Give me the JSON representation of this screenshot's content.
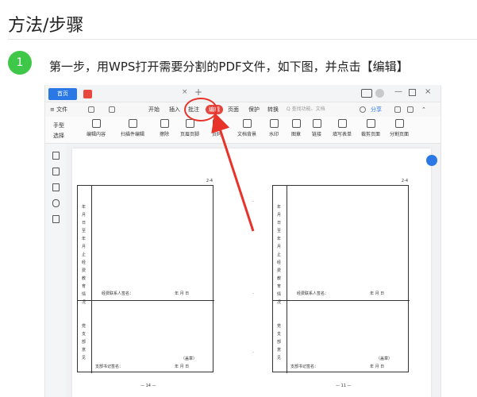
{
  "heading": {
    "title": "方法/步骤"
  },
  "step": {
    "number": "1",
    "text": "第一步，用WPS打开需要分割的PDF文件，如下图，并点击【编辑】"
  },
  "colors": {
    "step_green": "#3fc74a",
    "wps_blue": "#2a78e6",
    "highlight_red": "#e8332a"
  },
  "app": {
    "tabs": {
      "home": "首页",
      "close": "×",
      "new": "+"
    },
    "window": {
      "minimize": "—",
      "close": "×"
    },
    "menu": {
      "file": "≡ 文件",
      "items": [
        "开始",
        "插入",
        "批注",
        "编辑",
        "页面",
        "保护",
        "转换"
      ],
      "search_placeholder": "Q 查找功能、文档",
      "share": "分享"
    },
    "modes": {
      "hand": "手型",
      "select": "选择"
    },
    "tools": [
      "编辑内容",
      "扫描件编辑",
      "擦除",
      "页眉页脚",
      "页码",
      "文档背景",
      "水印",
      "图章",
      "链接",
      "填写表单",
      "裁剪页面",
      "分割页面"
    ],
    "left_icons": [
      "bookmark-icon",
      "image-icon",
      "comment-icon",
      "attachment-icon",
      "signature-icon"
    ]
  },
  "document": {
    "left_form": {
      "corner_number": "2-4",
      "upper_vertical": "年月日至年月止经费教育情况",
      "lower_vertical": "党支部意见",
      "upper_signature": "经费联系人签名：",
      "upper_date": "年  月  日",
      "lower_seal": "（盖章）",
      "lower_signature": "支部书记签名：",
      "lower_date": "年  月  日",
      "footer": "— 14 —"
    },
    "right_form": {
      "corner_number": "2-4",
      "upper_vertical": "年月日至年月止经费教育情况",
      "lower_vertical": "党支部意见",
      "upper_signature": "经费联系人签名：",
      "upper_date": "年  月  日",
      "lower_seal": "（盖章）",
      "lower_signature": "支部书记签名：",
      "lower_date": "年  月  日",
      "footer": "— 11 —"
    }
  }
}
